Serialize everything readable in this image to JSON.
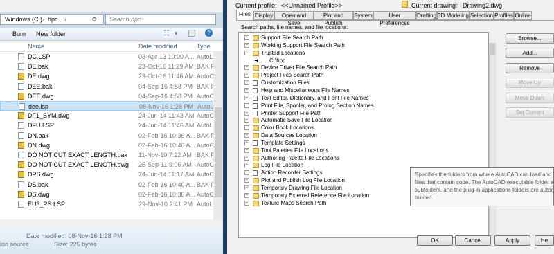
{
  "explorer": {
    "breadcrumb": [
      "Windows (C:)",
      "hpc"
    ],
    "search_placeholder": "Search hpc",
    "toolbar": {
      "burn": "Burn",
      "new_folder": "New folder"
    },
    "columns": {
      "name": "Name",
      "date": "Date modified",
      "type": "Type"
    },
    "files": [
      {
        "name": "DC.LSP",
        "date": "03-Apr-13 10:00 A...",
        "type": "AutoLIS",
        "icon": "doc"
      },
      {
        "name": "DE.bak",
        "date": "23-Oct-16 11:29 AM",
        "type": "BAK Fil",
        "icon": "doc"
      },
      {
        "name": "DE.dwg",
        "date": "23-Oct-16 11:46 AM",
        "type": "AutoCA",
        "icon": "dwg"
      },
      {
        "name": "DEE.bak",
        "date": "04-Sep-16 4:58 PM",
        "type": "BAK Fil",
        "icon": "doc"
      },
      {
        "name": "DEE.dwg",
        "date": "04-Sep-16 4:58 PM",
        "type": "AutoCA",
        "icon": "dwg"
      },
      {
        "name": "dee.lsp",
        "date": "08-Nov-16 1:28 PM",
        "type": "AutoLIS",
        "icon": "doc",
        "selected": true
      },
      {
        "name": "DF1_SYM.dwg",
        "date": "24-Jun-14 11:43 AM",
        "type": "AutoCA",
        "icon": "dwg"
      },
      {
        "name": "DFU.LSP",
        "date": "24-Jun-14 11:46 AM",
        "type": "AutoLIS",
        "icon": "doc"
      },
      {
        "name": "DN.bak",
        "date": "02-Feb-16 10:36 A...",
        "type": "BAK Fil",
        "icon": "doc"
      },
      {
        "name": "DN.dwg",
        "date": "02-Feb-16 10:40 A...",
        "type": "AutoCA",
        "icon": "dwg"
      },
      {
        "name": "DO NOT CUT EXACT LENGTH.bak",
        "date": "11-Nov-10 7:22 AM",
        "type": "BAK Fil",
        "icon": "doc"
      },
      {
        "name": "DO NOT CUT EXACT LENGTH.dwg",
        "date": "25-Sep-11 9:06 AM",
        "type": "AutoCA",
        "icon": "dwg"
      },
      {
        "name": "DPS.dwg",
        "date": "24-Jun-14 11:17 AM",
        "type": "AutoCA",
        "icon": "dwg"
      },
      {
        "name": "DS.bak",
        "date": "02-Feb-16 10:40 A...",
        "type": "BAK Fil",
        "icon": "doc"
      },
      {
        "name": "DS.dwg",
        "date": "02-Feb-16 10:36 A...",
        "type": "AutoCA",
        "icon": "dwg"
      },
      {
        "name": "EU3_PS.LSP",
        "date": "29-Nov-10 2:41 PM",
        "type": "AutoLIS",
        "icon": "doc"
      }
    ],
    "status": {
      "date_modified": "Date modified: 08-Nov-16 1:28 PM",
      "size": "Size: 225 bytes",
      "left_fragment": "ion source"
    }
  },
  "dialog": {
    "current_profile_label": "Current profile:",
    "current_profile_value": "<<Unnamed Profile>>",
    "current_drawing_label": "Current drawing:",
    "current_drawing_value": "Drawing2.dwg",
    "tabs": [
      "Files",
      "Display",
      "Open and Save",
      "Plot and Publish",
      "System",
      "User Preferences",
      "Drafting",
      "3D Modeling",
      "Selection",
      "Profiles",
      "Online"
    ],
    "tree_caption": "Search paths, file names, and file locations:",
    "tree": [
      {
        "label": "Support File Search Path",
        "icon": "folder",
        "exp": "+",
        "indent": 0
      },
      {
        "label": "Working Support File Search Path",
        "icon": "folder",
        "exp": "+",
        "indent": 0
      },
      {
        "label": "Trusted Locations",
        "icon": "folder",
        "exp": "-",
        "indent": 0
      },
      {
        "label": "C:\\hpc",
        "icon": "arrow",
        "exp": "",
        "indent": 1
      },
      {
        "label": "Device Driver File Search Path",
        "icon": "folder",
        "exp": "+",
        "indent": 0
      },
      {
        "label": "Project Files Search Path",
        "icon": "folder",
        "exp": "+",
        "indent": 0
      },
      {
        "label": "Customization Files",
        "icon": "page",
        "exp": "+",
        "indent": 0
      },
      {
        "label": "Help and Miscellaneous File Names",
        "icon": "page",
        "exp": "+",
        "indent": 0
      },
      {
        "label": "Text Editor, Dictionary, and Font File Names",
        "icon": "page",
        "exp": "+",
        "indent": 0
      },
      {
        "label": "Print File, Spooler, and Prolog Section Names",
        "icon": "page",
        "exp": "+",
        "indent": 0
      },
      {
        "label": "Printer Support File Path",
        "icon": "page",
        "exp": "+",
        "indent": 0
      },
      {
        "label": "Automatic Save File Location",
        "icon": "folder",
        "exp": "+",
        "indent": 0
      },
      {
        "label": "Color Book Locations",
        "icon": "folder",
        "exp": "+",
        "indent": 0
      },
      {
        "label": "Data Sources Location",
        "icon": "folder",
        "exp": "+",
        "indent": 0
      },
      {
        "label": "Template Settings",
        "icon": "page",
        "exp": "+",
        "indent": 0
      },
      {
        "label": "Tool Palettes File Locations",
        "icon": "folder",
        "exp": "+",
        "indent": 0
      },
      {
        "label": "Authoring Palette File Locations",
        "icon": "folder",
        "exp": "+",
        "indent": 0
      },
      {
        "label": "Log File Location",
        "icon": "folder",
        "exp": "+",
        "indent": 0
      },
      {
        "label": "Action Recorder Settings",
        "icon": "page",
        "exp": "+",
        "indent": 0
      },
      {
        "label": "Plot and Publish Log File Location",
        "icon": "folder",
        "exp": "+",
        "indent": 0
      },
      {
        "label": "Temporary Drawing File Location",
        "icon": "folder",
        "exp": "+",
        "indent": 0
      },
      {
        "label": "Temporary External Reference File Location",
        "icon": "folder",
        "exp": "+",
        "indent": 0
      },
      {
        "label": "Texture Maps Search Path",
        "icon": "folder",
        "exp": "+",
        "indent": 0
      }
    ],
    "side_buttons": [
      {
        "label": "Browse...",
        "enabled": true
      },
      {
        "label": "Add...",
        "enabled": true
      },
      {
        "label": "Remove",
        "enabled": true
      },
      {
        "label": "Move Up",
        "enabled": false
      },
      {
        "label": "Move Down",
        "enabled": false
      },
      {
        "label": "Set Current",
        "enabled": false
      }
    ],
    "tooltip_lines": [
      "Specifies the folders from where AutoCAD can load and e",
      "files that contain code. The AutoCAD executable folder a",
      "subfolders, and the plug-in applications folders are autor",
      "trusted."
    ],
    "bottom_buttons": [
      "OK",
      "Cancel",
      "Apply",
      "He"
    ]
  },
  "colors": {
    "selection": "#cce4f7",
    "desktop": "#1c3b63",
    "explorer_chrome": "#cfdcec"
  }
}
